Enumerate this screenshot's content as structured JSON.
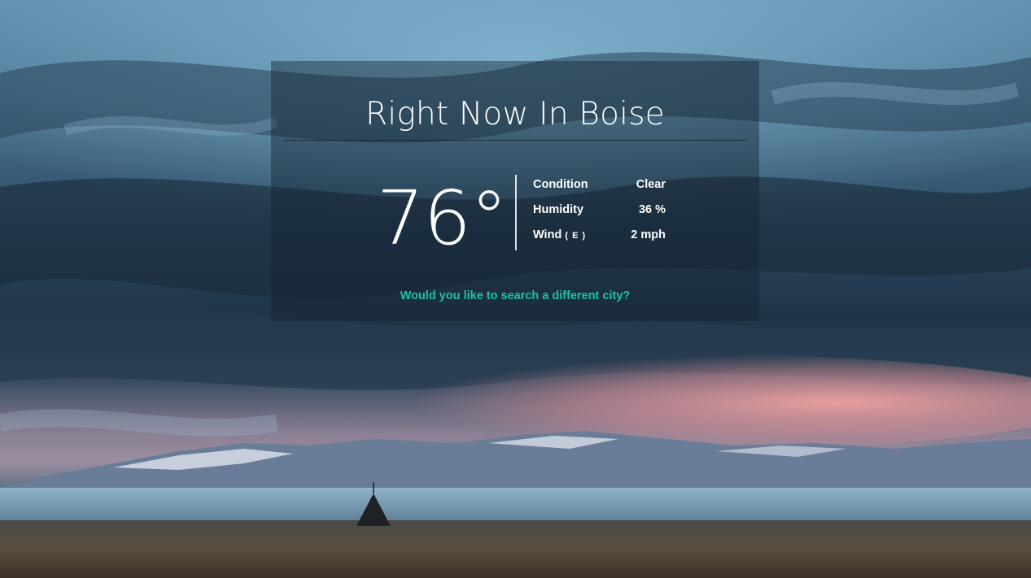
{
  "weather": {
    "title": "Right Now In Boise",
    "temperature": "76°",
    "stats": [
      {
        "label": "Condition",
        "sub": "",
        "value": "Clear"
      },
      {
        "label": "Humidity",
        "sub": "",
        "value": "36 %"
      },
      {
        "label": "Wind",
        "sub": "( E )",
        "value": "2 mph"
      }
    ],
    "search_link": "Would you like to search a different city?"
  },
  "colors": {
    "link": "#1fc0a2",
    "text": "#ffffff",
    "panel": "rgba(20, 34, 48, 0.42)"
  }
}
